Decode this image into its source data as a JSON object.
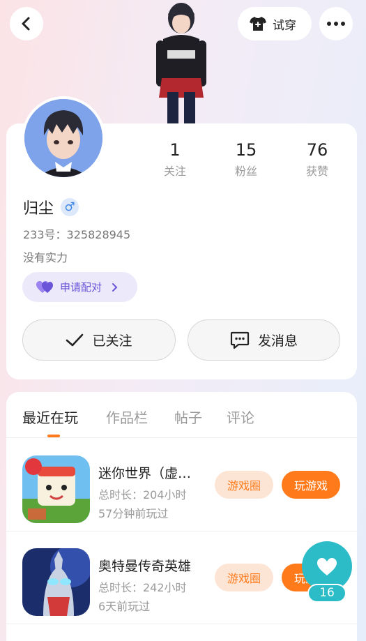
{
  "header": {
    "back_icon": "chevron-left-icon",
    "tryon_label": "试穿",
    "tryon_icon": "tshirt-plus-icon",
    "more_icon": "more-dots-icon"
  },
  "profile": {
    "stats": [
      {
        "value": "1",
        "label": "关注"
      },
      {
        "value": "15",
        "label": "粉丝"
      },
      {
        "value": "76",
        "label": "获赞"
      }
    ],
    "name": "归尘",
    "gender_symbol": "♂",
    "uid": "233号：325828945",
    "bio": "没有实力",
    "pair_label": "申请配对",
    "follow_label": "已关注",
    "message_label": "发消息"
  },
  "tabs": [
    "最近在玩",
    "作品栏",
    "帖子",
    "评论"
  ],
  "games": [
    {
      "title": "迷你世界（虚…",
      "duration": "总时长：204小时",
      "last_played": "57分钟前玩过",
      "circle_label": "游戏圈",
      "play_label": "玩游戏"
    },
    {
      "title": "奥特曼传奇英雄",
      "duration": "总时长：242小时",
      "last_played": "6天前玩过",
      "circle_label": "游戏圈",
      "play_label": "玩游戏"
    }
  ],
  "like_float": {
    "count": "16",
    "icon": "heart-icon"
  },
  "colors": {
    "accent": "#ff7a1a",
    "teal": "#2bbcc8",
    "purple": "#6a55d8"
  }
}
